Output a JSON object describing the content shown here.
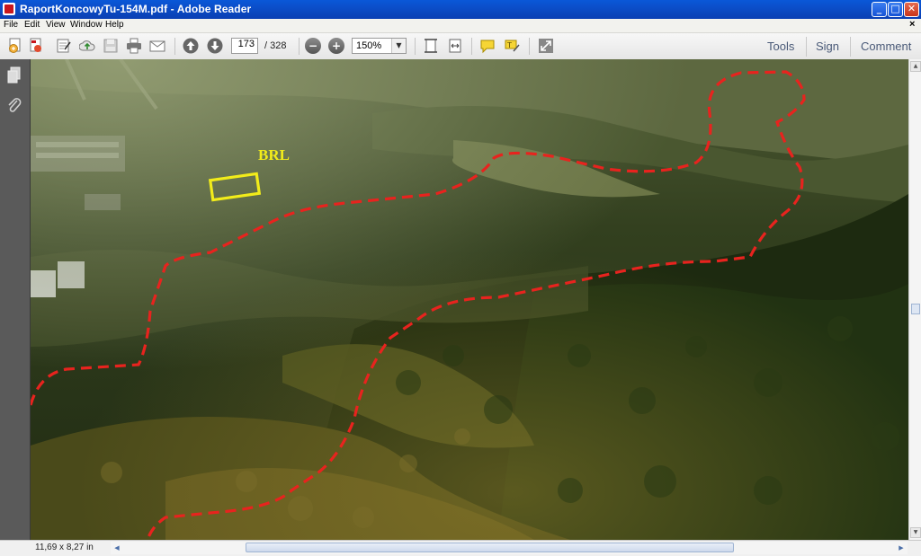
{
  "window": {
    "title": "RaportKoncowyTu-154M.pdf - Adobe Reader",
    "minimize_label": "_",
    "maximize_label": "□",
    "close_label": "✕"
  },
  "menu": {
    "file": "File",
    "edit": "Edit",
    "view": "View",
    "window": "Window",
    "help": "Help",
    "close_doc": "×"
  },
  "toolbar": {
    "page_current": "173",
    "page_total": "/ 328",
    "zoom_minus": "−",
    "zoom_plus": "+",
    "zoom_value": "150%",
    "zoom_arrow": "▼",
    "tools": "Tools",
    "sign": "Sign",
    "comment": "Comment",
    "icons": [
      "create-pdf-icon",
      "edit-pdf-icon",
      "sign-form-icon",
      "cloud-upload-icon",
      "save-icon",
      "print-icon",
      "email-icon",
      "prev-page-icon",
      "next-page-icon",
      "zoom-out-icon",
      "zoom-in-icon",
      "fit-page-icon",
      "fit-width-icon",
      "comment-bubble-icon",
      "highlight-icon",
      "fullscreen-icon"
    ]
  },
  "document": {
    "annotation_label": "BRL",
    "route_color": "#e8231e",
    "box_color": "#f2ec1a",
    "label_color": "#f2ec1a"
  },
  "status": {
    "page_size": "11,69 x 8,27 in"
  },
  "scroll": {
    "up": "▲",
    "down": "▼",
    "left": "◀",
    "right": "▶"
  }
}
